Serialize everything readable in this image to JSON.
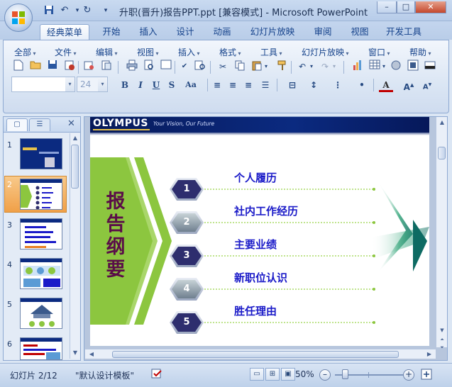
{
  "window": {
    "title": "升职(晋升)报告PPT.ppt [兼容模式] - Microsoft PowerPoint",
    "controls": {
      "minimize": "–",
      "maximize": "□",
      "close": "✕"
    }
  },
  "quick_access": [
    {
      "icon": "save-icon",
      "glyph": "💾"
    },
    {
      "icon": "undo-icon",
      "glyph": "↶"
    },
    {
      "icon": "redo-icon",
      "glyph": "↻"
    },
    {
      "icon": "customize-icon",
      "glyph": "▾"
    }
  ],
  "ribbon_tabs": [
    "经典菜单",
    "开始",
    "插入",
    "设计",
    "动画",
    "幻灯片放映",
    "审阅",
    "视图",
    "开发工具"
  ],
  "active_tab": "经典菜单",
  "classic_menu": [
    "全部",
    "文件",
    "编辑",
    "视图",
    "插入",
    "格式",
    "工具",
    "幻灯片放映",
    "窗口",
    "帮助"
  ],
  "format_bar": {
    "font_name": "",
    "font_size": "24"
  },
  "left_panel": {
    "close_glyph": "✕",
    "slides": [
      {
        "num": "1"
      },
      {
        "num": "2",
        "selected": true
      },
      {
        "num": "3"
      },
      {
        "num": "4"
      },
      {
        "num": "5"
      },
      {
        "num": "6"
      }
    ]
  },
  "slide": {
    "brand": "OLYMPUS",
    "tagline": "Your Vision, Our Future",
    "outline_title": "报告纲要",
    "items": [
      {
        "num": "1",
        "text": "个人履历"
      },
      {
        "num": "2",
        "text": "社内工作经历"
      },
      {
        "num": "3",
        "text": "主要业绩"
      },
      {
        "num": "4",
        "text": "新职位认识"
      },
      {
        "num": "5",
        "text": "胜任理由"
      }
    ]
  },
  "status_bar": {
    "slide_indicator": "幻灯片 2/12",
    "theme": "\"默认设计模板\"",
    "zoom": "50%",
    "zoom_fraction": 0.15
  },
  "colors": {
    "accent": "#15428b",
    "banner": "#0b2a80",
    "title_text": "#5a0d48",
    "item_text": "#1a1ac8",
    "green": "#8cc63f",
    "selected_thumb": "#f0a048"
  }
}
